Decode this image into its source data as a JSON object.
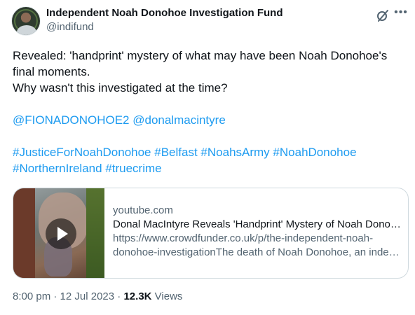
{
  "author": {
    "name": "Independent Noah Donohoe Investigation Fund",
    "handle": "@indifund"
  },
  "tweet": {
    "line1": "Revealed: 'handprint' mystery of what may have been Noah Donohoe's",
    "line2": "final moments.",
    "line3": "Why wasn't this investigated at the time?",
    "mentions": [
      "@FIONADONOHOE2",
      "@donalmacintyre"
    ],
    "hashtags_line1": [
      "#JusticeForNoahDonohoe",
      "#Belfast",
      "#NoahsArmy",
      "#NoahDonohoe"
    ],
    "hashtags_line2": [
      "#NorthernIreland",
      "#truecrime"
    ]
  },
  "card": {
    "domain": "youtube.com",
    "title": "Donal MacIntyre Reveals 'Handprint' Mystery of Noah Donohoe",
    "desc_line1": "https://www.crowdfunder.co.uk/p/the-independent-noah-",
    "desc_line2": "donohoe-investigationThe death of Noah Donohoe, an independent investigation"
  },
  "meta": {
    "time": "8:00 pm",
    "separator1": "·",
    "date": "12 Jul 2023",
    "separator2": "·",
    "views_count": "12.3K",
    "views_label": "Views"
  },
  "icons": {
    "grok": "grok-icon",
    "more": "more-icon",
    "play": "play-icon"
  },
  "colors": {
    "link": "#1d9bf0",
    "text": "#0f1419",
    "secondary": "#536471"
  }
}
